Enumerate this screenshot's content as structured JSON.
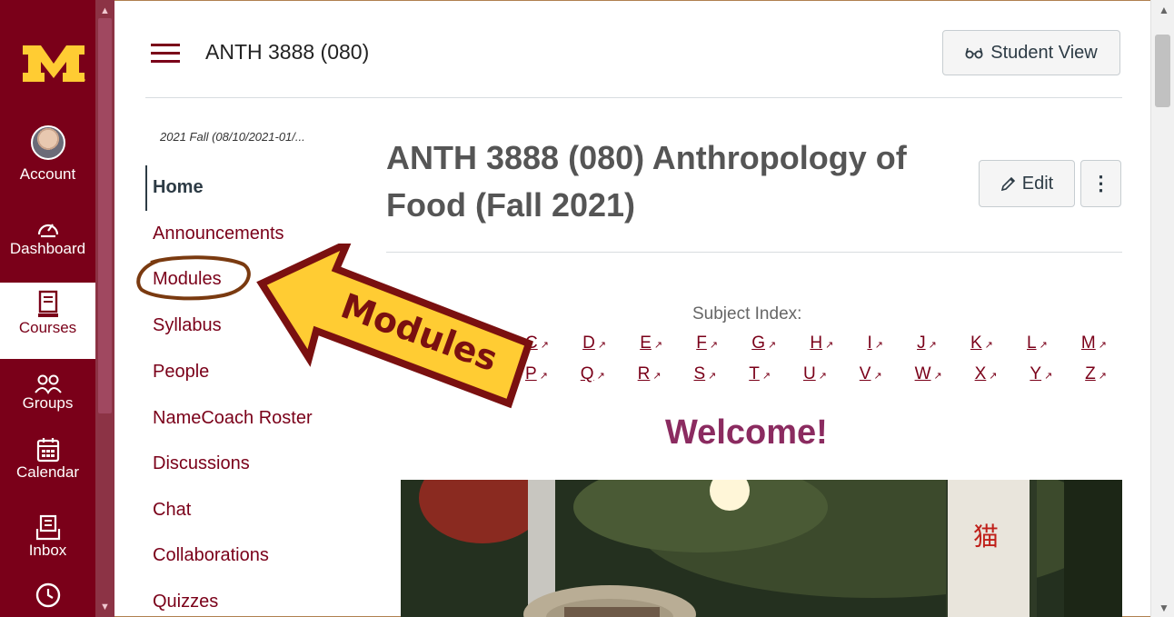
{
  "global_nav": {
    "logo_icon": "university-m-logo",
    "items": [
      {
        "label": "Account",
        "icon": "avatar"
      },
      {
        "label": "Dashboard",
        "icon": "dashboard-icon"
      },
      {
        "label": "Courses",
        "icon": "courses-icon",
        "active": true
      },
      {
        "label": "Groups",
        "icon": "groups-icon"
      },
      {
        "label": "Calendar",
        "icon": "calendar-icon"
      },
      {
        "label": "Inbox",
        "icon": "inbox-icon"
      },
      {
        "label": "",
        "icon": "history-icon"
      }
    ]
  },
  "header": {
    "breadcrumb": "ANTH 3888 (080)",
    "student_view_label": "Student View"
  },
  "course_nav": {
    "term": "2021 Fall (08/10/2021-01/...",
    "items": [
      "Home",
      "Announcements",
      "Modules",
      "Syllabus",
      "People",
      "NameCoach Roster",
      "Discussions",
      "Chat",
      "Collaborations",
      "Quizzes"
    ],
    "active": "Home"
  },
  "content": {
    "title_line1": "ANTH 3888 (080) Anthropology of",
    "title_line2": "Food (Fall 2021)",
    "edit_label": "Edit",
    "subject_index_label": "Subject Index:",
    "letters_row1": [
      "C",
      "D",
      "E",
      "F",
      "G",
      "H",
      "I",
      "J",
      "K",
      "L",
      "M"
    ],
    "letters_row2": [
      "P",
      "Q",
      "R",
      "S",
      "T",
      "U",
      "V",
      "W",
      "X",
      "Y",
      "Z"
    ],
    "welcome": "Welcome!"
  },
  "annotation": {
    "arrow_text": "Modules"
  },
  "colors": {
    "maroon": "#7a0019",
    "gold": "#ffcc33",
    "welcome": "#8b2b60",
    "annotation_brown": "#7a3a10"
  }
}
